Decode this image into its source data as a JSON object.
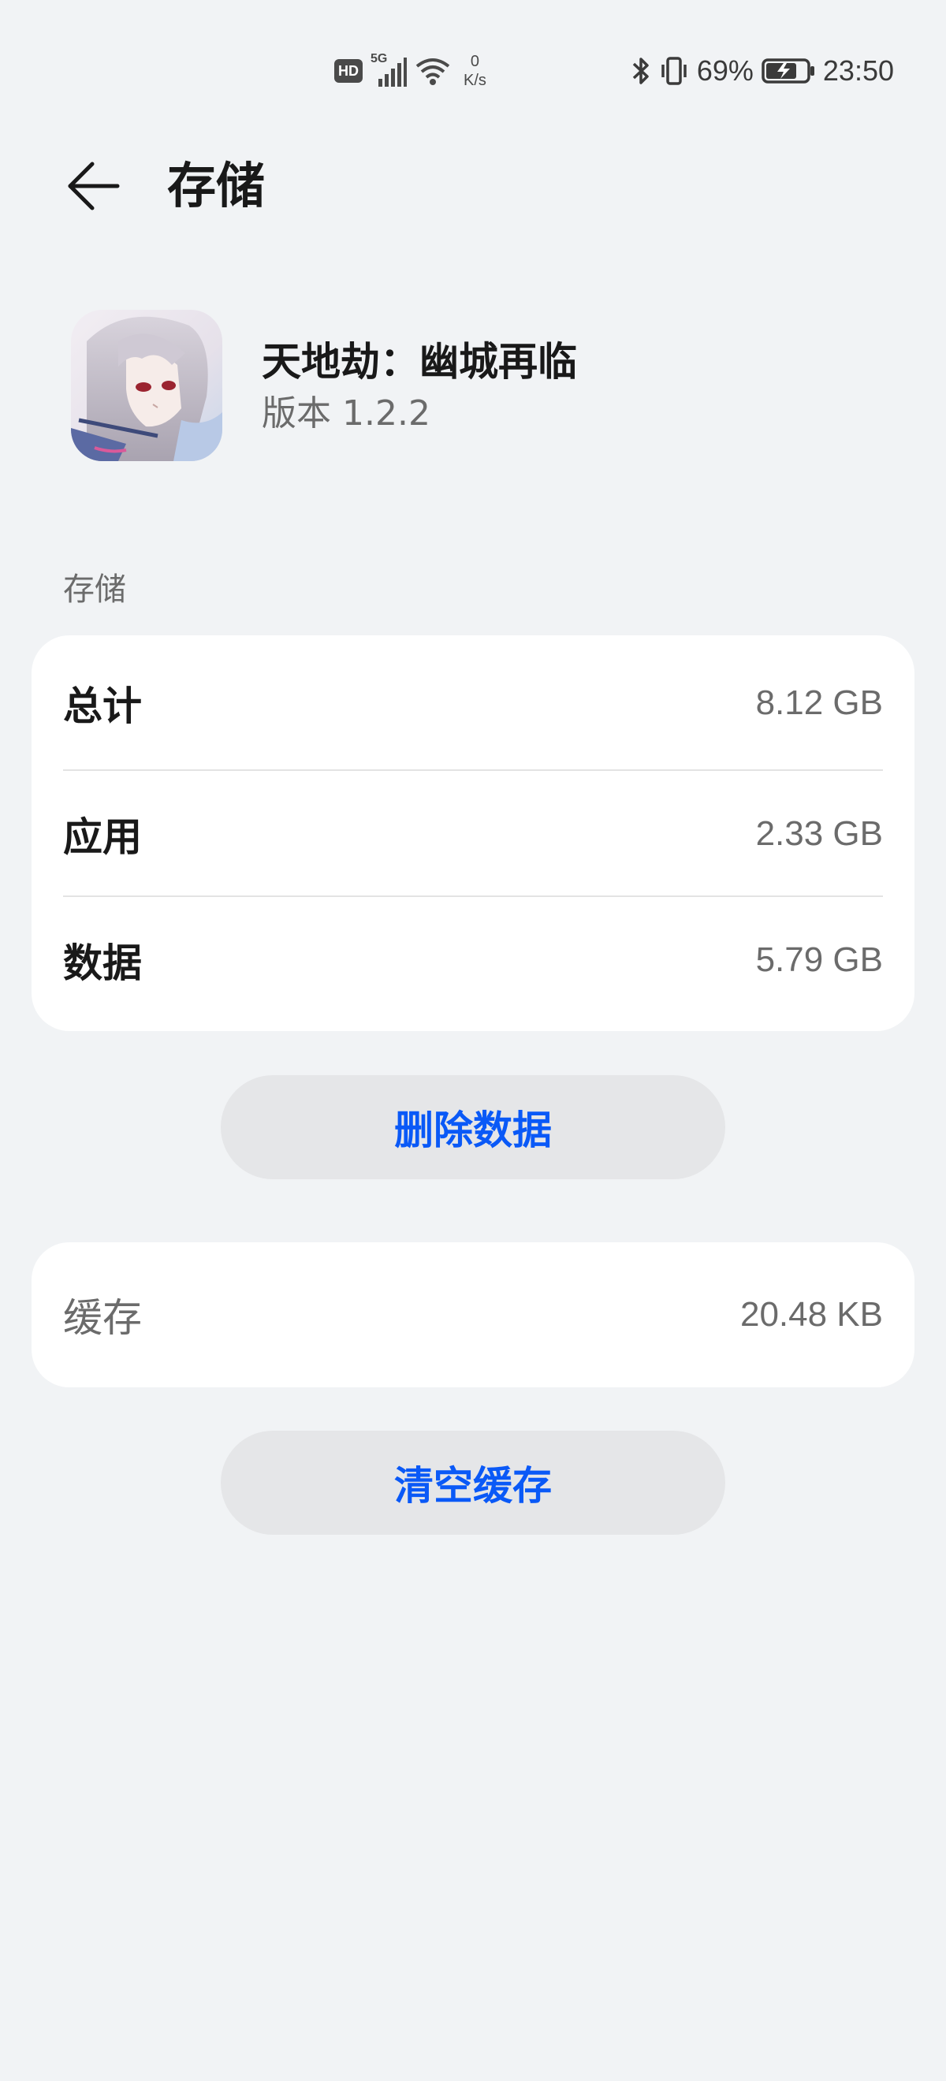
{
  "status_bar": {
    "hd_badge": "HD",
    "network_type": "5G",
    "net_speed_value": "0",
    "net_speed_unit": "K/s",
    "battery_percent": "69%",
    "time": "23:50"
  },
  "header": {
    "title": "存储"
  },
  "app": {
    "name": "天地劫：幽城再临",
    "version": "版本 1.2.2"
  },
  "storage": {
    "section_label": "存储",
    "rows": [
      {
        "label": "总计",
        "value": "8.12 GB"
      },
      {
        "label": "应用",
        "value": "2.33 GB"
      },
      {
        "label": "数据",
        "value": "5.79 GB"
      }
    ],
    "delete_button_label": "删除数据"
  },
  "cache": {
    "label": "缓存",
    "value": "20.48 KB",
    "clear_button_label": "清空缓存"
  },
  "colors": {
    "background": "#f1f3f5",
    "card": "#ffffff",
    "accent": "#0a59f7",
    "button_bg": "#e5e6e8"
  }
}
